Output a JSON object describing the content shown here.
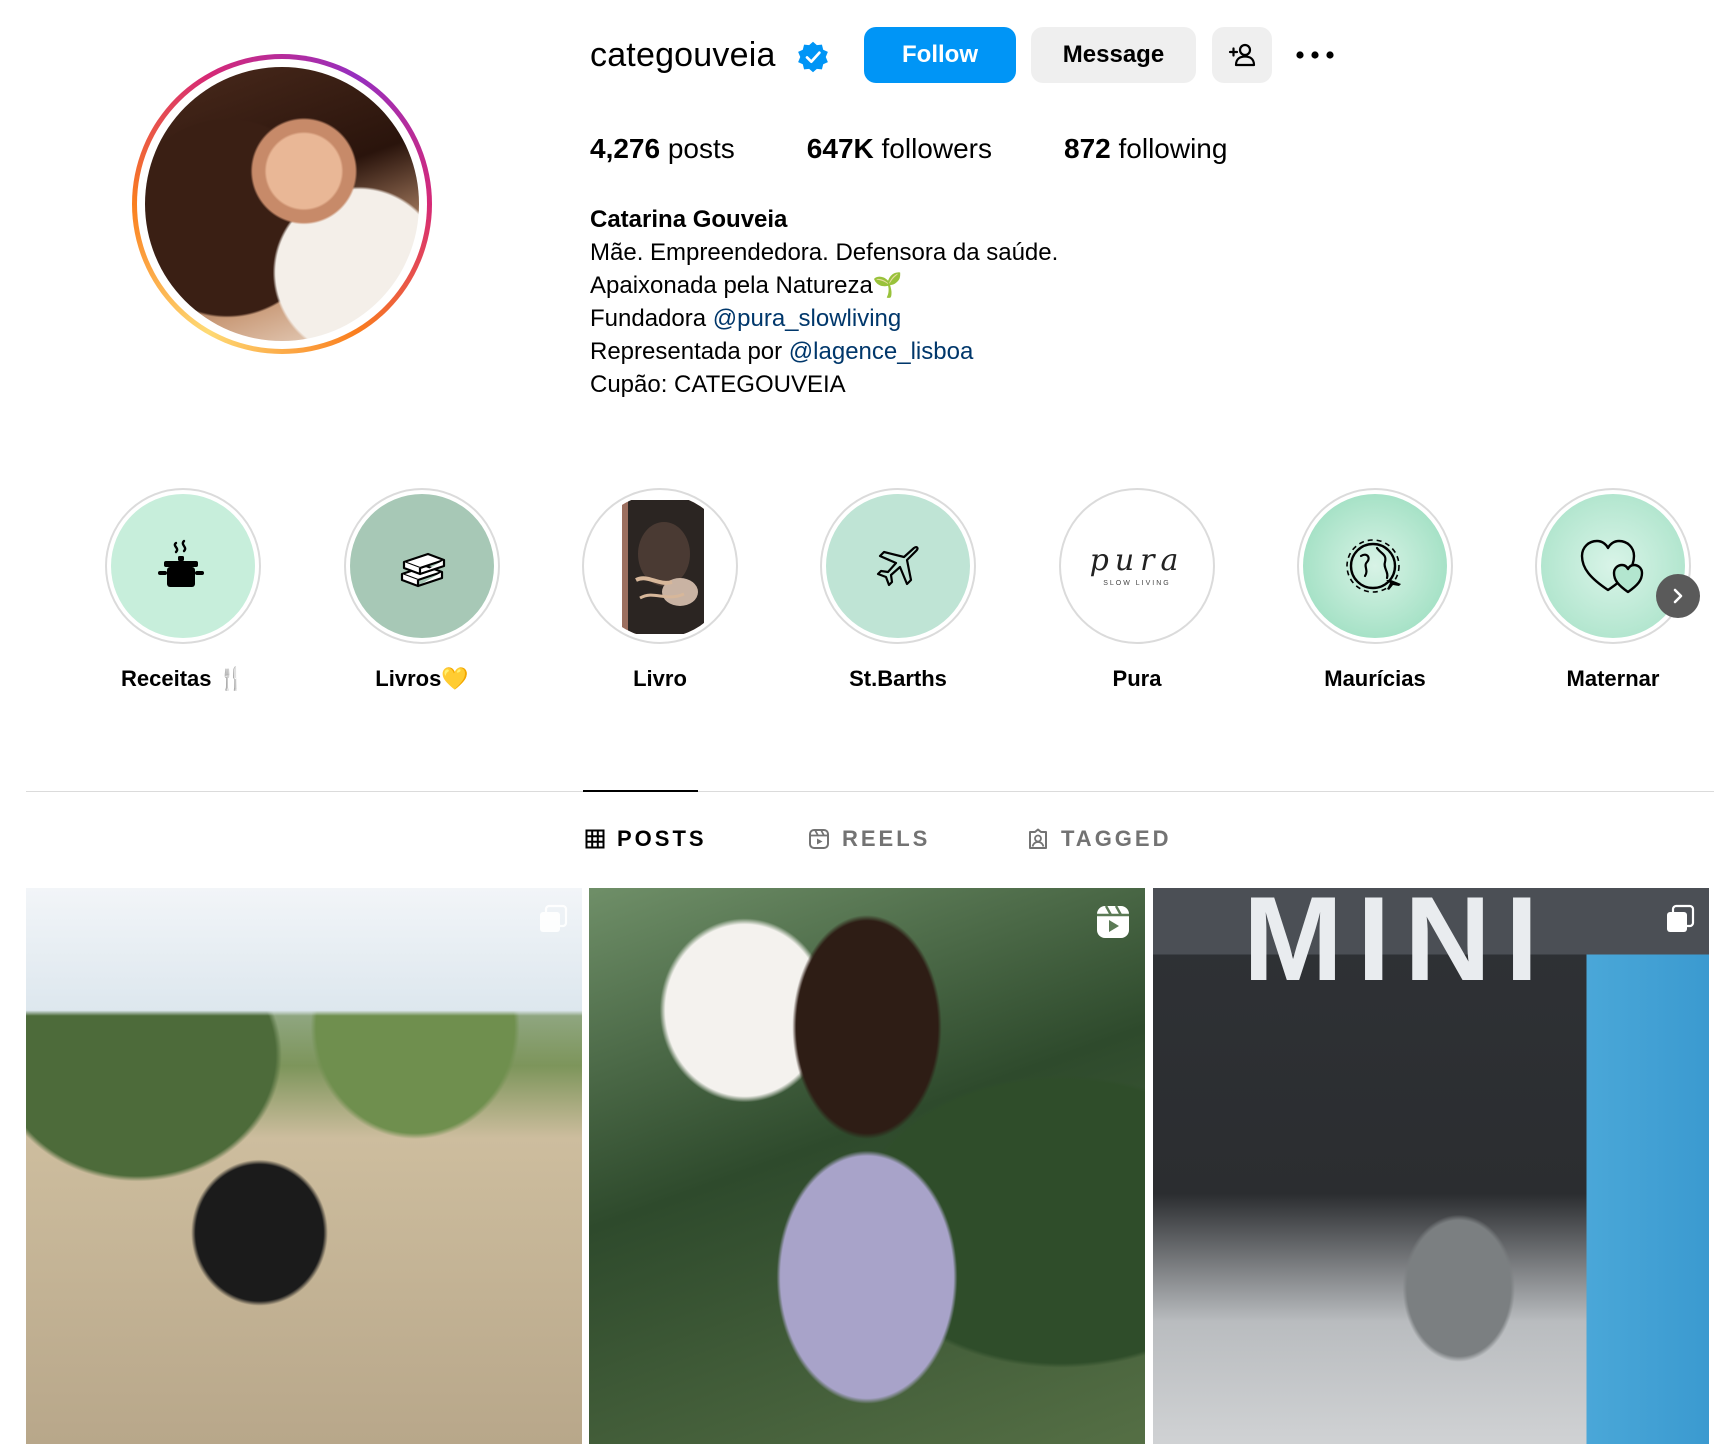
{
  "profile": {
    "username": "categouveia",
    "verified": true,
    "follow_label": "Follow",
    "message_label": "Message",
    "stats": {
      "posts_count": "4,276",
      "posts_label": "posts",
      "followers_count": "647K",
      "followers_label": "followers",
      "following_count": "872",
      "following_label": "following"
    },
    "bio": {
      "name": "Catarina Gouveia",
      "line1": "Mãe. Empreendedora. Defensora da saúde.",
      "line2": "Apaixonada pela Natureza🌱",
      "line3_prefix": "Fundadora ",
      "line3_link": "@pura_slowliving",
      "line4_prefix": "Representada por ",
      "line4_link": "@lagence_lisboa",
      "line5": "Cupão: CATEGOUVEIA"
    }
  },
  "highlights": [
    {
      "label": "Receitas 🍴",
      "icon": "cooking-pot-icon",
      "bg": "#c7eedb"
    },
    {
      "label": "Livros💛",
      "icon": "books-icon",
      "bg": "#a7c8b6"
    },
    {
      "label": "Livro",
      "icon": "book-cover",
      "bg": "#2b2522"
    },
    {
      "label": "St.Barths",
      "icon": "airplane-icon",
      "bg": "#bfe4d5"
    },
    {
      "label": "Pura",
      "icon": "pura-logo",
      "bg": "#ffffff",
      "logo_text": "pura",
      "logo_sub": "SLOW LIVING"
    },
    {
      "label": "Maurícias",
      "icon": "globe-plane-icon",
      "bg": "#a7e2c7"
    },
    {
      "label": "Maternar",
      "icon": "hearts-icon",
      "bg": "#b3e6cf"
    }
  ],
  "tabs": [
    {
      "label": "POSTS",
      "icon": "grid-icon",
      "active": true
    },
    {
      "label": "REELS",
      "icon": "reels-icon",
      "active": false
    },
    {
      "label": "TAGGED",
      "icon": "tagged-icon",
      "active": false
    }
  ],
  "posts": [
    {
      "type": "carousel",
      "icon": "carousel-icon"
    },
    {
      "type": "reel",
      "icon": "reel-icon"
    },
    {
      "type": "carousel",
      "icon": "carousel-icon",
      "sign_text": "MINI"
    }
  ],
  "colors": {
    "accent": "#0095f6",
    "link": "#00376b",
    "secondary_button": "#efefef"
  }
}
